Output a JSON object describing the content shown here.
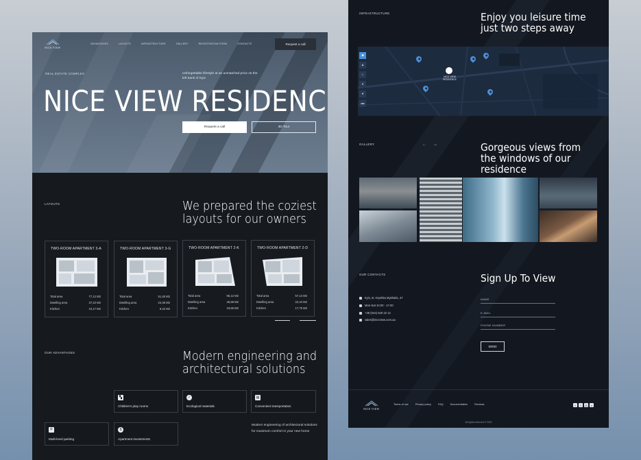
{
  "brand": {
    "logo_text": "NICE VIEW"
  },
  "nav": {
    "items": [
      "ADVANTAGES",
      "LAYOUTS",
      "INFRASTRUCTURE",
      "GALLERY",
      "REGISTRATION FORM",
      "CONTACTS"
    ],
    "cta": "Request a call"
  },
  "hero": {
    "eyebrow": "REAL ESTATE COMPLEX",
    "subtitle": "Unforgettable lifestyle at an unmatched price on the left bank of Kyiv",
    "title": "NICE VIEW RESIDENCE",
    "primary_button": "Request a call",
    "secondary_button": "3D Tour"
  },
  "layouts": {
    "label": "LAYOUTS",
    "heading": "We prepared the coziest layouts for our owners",
    "cards": [
      {
        "title": "TWO-ROOM APARTMENT 3-A",
        "total_label": "Total area",
        "total": "77,12 M2",
        "dwelling_label": "Dwelling area",
        "dwelling": "37,22 M2",
        "kitchen_label": "Kitchen",
        "kitchen": "10,17 M2"
      },
      {
        "title": "TWO-ROOM APARTMENT 3-G",
        "total_label": "Total area",
        "total": "51,45 M2",
        "dwelling_label": "Dwelling area",
        "dwelling": "24,35 M2",
        "kitchen_label": "Kitchen",
        "kitchen": "9,42 M2"
      },
      {
        "title": "TWO-ROOM APARTMENT 2-K",
        "total_label": "Total area",
        "total": "65,12 M2",
        "dwelling_label": "Dwelling area",
        "dwelling": "45,58 M2",
        "kitchen_label": "Kitchen",
        "kitchen": "19,55 M2"
      },
      {
        "title": "TWO-ROOM APARTMENT 2-D",
        "total_label": "Total area",
        "total": "57,14 M2",
        "dwelling_label": "Dwelling area",
        "dwelling": "22,44 M2",
        "kitchen_label": "Kitchen",
        "kitchen": "17,75 M2"
      }
    ]
  },
  "advantages": {
    "label": "OUR ADVANTAGES",
    "heading": "Modern engineering and architectural solutions",
    "items": [
      "Children's play rooms",
      "Ecological materials",
      "Convenient transportation",
      "Multi-level parking",
      "Apartment investments"
    ],
    "text": "Modern engineering of architectural solutions for maximum comfort in your new home"
  },
  "infrastructure": {
    "label": "INFRASTRUCTURE",
    "heading": "Enjoy you leisure time just two steps away",
    "map_label": "NICE VIEW RESIDENCE"
  },
  "gallery": {
    "label": "GALLERY",
    "heading": "Gorgeous views from the windows of our residence"
  },
  "contacts": {
    "label": "OUR CONTACTS",
    "address": "Kyiv, st. Hryshka Mykhaila, 47",
    "hours": "Mon-Sat 10.00 - 17.00",
    "phone": "+38 (044) 540 22 12",
    "email": "sales@niceview.com.ua"
  },
  "signup": {
    "heading": "Sign Up To View",
    "name_placeholder": "NAME",
    "email_placeholder": "E-MAIL",
    "phone_placeholder": "PHONE NUMBER",
    "send": "SEND"
  },
  "footer": {
    "links": [
      "Terms of use",
      "Privacy policy",
      "FAQ",
      "Documentation",
      "Reviews"
    ],
    "copyright": "All rights reserved © 2022"
  }
}
